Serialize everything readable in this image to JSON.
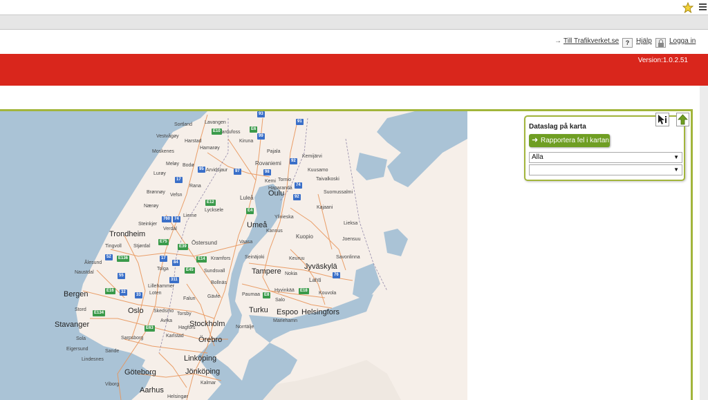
{
  "browser": {
    "bookmark_icon": "star-icon",
    "menu_icon": "hamburger-menu-icon"
  },
  "toplinks": {
    "trafikverket": "Till Trafikverket.se",
    "help_symbol": "?",
    "help": "Hjälp",
    "login": "Logga in"
  },
  "header": {
    "version": "Version:1.0.2.51",
    "accent_color": "#d9261c"
  },
  "panel": {
    "title": "Dataslag på karta",
    "report_button": "Rapportera fel i kartan",
    "select_1": "Alla",
    "select_2": "",
    "info_tool_icon": "cursor-info-icon",
    "expand_tool_icon": "green-arrow-up-icon",
    "accent_color": "#a2b53b"
  },
  "map": {
    "cities": [
      "Trondheim",
      "Umeå",
      "Oulu",
      "Vaasa",
      "Bergen",
      "Oslo",
      "Stockholm",
      "Tampere",
      "Jyväskylä",
      "Turku",
      "Espoo",
      "Helsingfors",
      "Göteborg",
      "Linköping",
      "Jönköping",
      "Örebro",
      "Rovaniemi",
      "Aarhus",
      "Stavanger",
      "Luleå",
      "Kuopio",
      "Lahti"
    ],
    "towns": [
      "Lavangen",
      "Sortland",
      "Vestvågøy",
      "Moskenes",
      "Harstad",
      "Bardufoss",
      "Hamarøy",
      "Kiruna",
      "Pajala",
      "Kemijärvi",
      "Kuusamo",
      "Taivalkoski",
      "Suomussalmi",
      "Kajaani",
      "Lieksa",
      "Joensuu",
      "Savonlinna",
      "Kouvola",
      "Salo",
      "Nokia",
      "Hyvinkää",
      "Seinäjoki",
      "Kramfors",
      "Sundsvall",
      "Bollnäs",
      "Gävle",
      "Falun",
      "Karlstad",
      "Sarpsborg",
      "Skedsmo",
      "Tolga",
      "Lillehammer",
      "Vefsn",
      "Rana",
      "Bodø",
      "Meløy",
      "Lurøy",
      "Brønnøy",
      "Nærøy",
      "Steinkjer",
      "Stjørdal",
      "Tingvoll",
      "Ålesund",
      "Naustdal",
      "Stord",
      "Sola",
      "Eigersund",
      "Lindesnes",
      "Viborg",
      "Helsingør",
      "Kalmar",
      "Norrtälje",
      "Mariehamn",
      "Lycksele",
      "Arvidsjaur",
      "Tornio",
      "Kemi",
      "Haparanda",
      "Paumaa",
      "Östersund",
      "Verdal",
      "Lierne",
      "Avika",
      "Loten",
      "Sande",
      "Torsby",
      "Ylivieska",
      "Kannus",
      "Keuruu",
      "Hagfors"
    ],
    "roads_e": [
      "E10",
      "E6",
      "E45",
      "E12",
      "E4",
      "E14",
      "E75",
      "E136",
      "E16",
      "E39",
      "E134",
      "E18",
      "E8",
      "E63"
    ],
    "roads_n": [
      "93",
      "99",
      "95",
      "97",
      "92",
      "98",
      "74",
      "91",
      "17",
      "760",
      "74",
      "55",
      "32",
      "33",
      "311",
      "84",
      "52",
      "17",
      "92",
      "76"
    ]
  }
}
